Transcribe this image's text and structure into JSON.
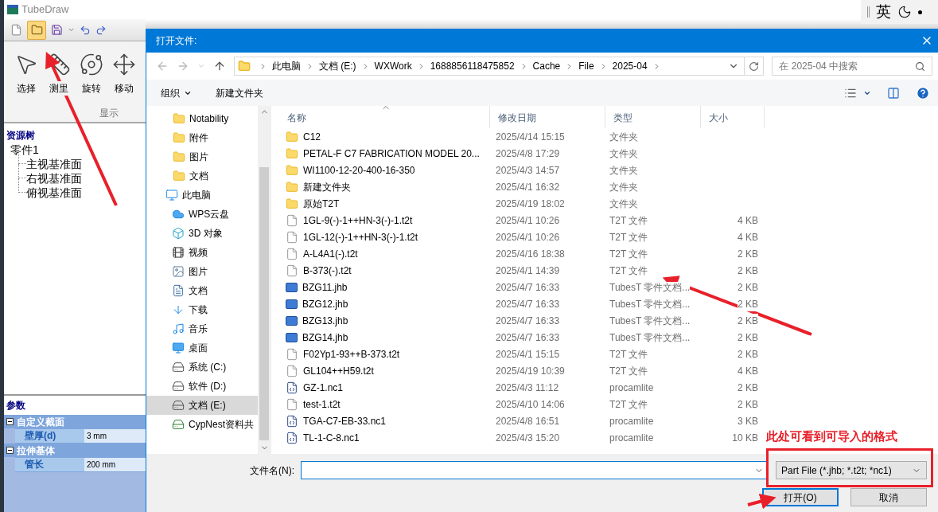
{
  "app": {
    "title": "TubeDraw",
    "ribbon": {
      "tools": [
        {
          "label": "选择",
          "kind": "pointer"
        },
        {
          "label": "测里",
          "kind": "ruler"
        },
        {
          "label": "旋转",
          "kind": "orbit"
        },
        {
          "label": "移动",
          "kind": "move"
        }
      ],
      "group": "显示"
    },
    "tree": {
      "title": "资源树",
      "root": {
        "label": "零件1",
        "children": [
          {
            "label": "主视基准面"
          },
          {
            "label": "右视基准面"
          },
          {
            "label": "俯视基准面"
          }
        ]
      }
    },
    "params": {
      "title": "参数",
      "groups": [
        {
          "label": "自定义截面",
          "expanded": true,
          "rows": [
            {
              "name": "壁厚(d)",
              "value": "3 mm"
            }
          ]
        },
        {
          "label": "拉伸基体",
          "expanded": true,
          "rows": [
            {
              "name": "管长",
              "value": "200 mm"
            }
          ]
        }
      ]
    }
  },
  "ime": {
    "label": "英"
  },
  "dialog": {
    "title": "打开文件:",
    "breadcrumb": [
      "此电脑",
      "文档 (E:)",
      "WXWork",
      "1688856118475852",
      "Cache",
      "File",
      "2025-04"
    ],
    "search": {
      "placeholder": "在 2025-04 中搜索"
    },
    "commands": [
      {
        "label": "组织",
        "dropdown": true
      },
      {
        "label": "新建文件夹",
        "dropdown": false
      }
    ],
    "nav": [
      {
        "label": "Notability",
        "kind": "folder",
        "selected": false
      },
      {
        "label": "附件",
        "kind": "folder",
        "selected": false
      },
      {
        "label": "图片",
        "kind": "folder",
        "selected": false
      },
      {
        "label": "文档",
        "kind": "folder",
        "selected": false
      },
      {
        "label": "此电脑",
        "kind": "computer",
        "selected": false
      },
      {
        "label": "WPS云盘",
        "kind": "cloud",
        "selected": false
      },
      {
        "label": "3D 对象",
        "kind": "cube",
        "selected": false
      },
      {
        "label": "视频",
        "kind": "video",
        "selected": false
      },
      {
        "label": "图片",
        "kind": "picture",
        "selected": false
      },
      {
        "label": "文档",
        "kind": "document",
        "selected": false
      },
      {
        "label": "下载",
        "kind": "download",
        "selected": false
      },
      {
        "label": "音乐",
        "kind": "music",
        "selected": false
      },
      {
        "label": "桌面",
        "kind": "desktop",
        "selected": false
      },
      {
        "label": "系统 (C:)",
        "kind": "drive",
        "selected": false
      },
      {
        "label": "软件 (D:)",
        "kind": "drive",
        "selected": false
      },
      {
        "label": "文档 (E:)",
        "kind": "drive",
        "selected": true
      },
      {
        "label": "CypNest资料共",
        "kind": "netdrive",
        "selected": false
      }
    ],
    "columns": [
      "名称",
      "修改日期",
      "类型",
      "大小"
    ],
    "files": [
      {
        "name": "C12",
        "date": "2025/4/14 15:15",
        "type": "文件夹",
        "kind": "folder"
      },
      {
        "name": "PETAL-F C7 FABRICATION MODEL 20...",
        "date": "2025/4/8 17:29",
        "type": "文件夹",
        "kind": "folder"
      },
      {
        "name": "WI1100-12-20-400-16-350",
        "date": "2025/4/3 14:57",
        "type": "文件夹",
        "kind": "folder"
      },
      {
        "name": "新建文件夹",
        "date": "2025/4/1 16:32",
        "type": "文件夹",
        "kind": "folder"
      },
      {
        "name": "原始T2T",
        "date": "2025/4/19 18:02",
        "type": "文件夹",
        "kind": "folder"
      },
      {
        "name": "1GL-9(-)-1++HN-3(-)-1.t2t",
        "date": "2025/4/1 10:26",
        "type": "T2T 文件",
        "size": "4 KB",
        "kind": "plain"
      },
      {
        "name": "1GL-12(-)-1++HN-3(-)-1.t2t",
        "date": "2025/4/1 10:26",
        "type": "T2T 文件",
        "size": "4 KB",
        "kind": "plain"
      },
      {
        "name": "A-L4A1(-).t2t",
        "date": "2025/4/16 18:38",
        "type": "T2T 文件",
        "size": "2 KB",
        "kind": "plain"
      },
      {
        "name": "B-373(-).t2t",
        "date": "2025/4/1 14:39",
        "type": "T2T 文件",
        "size": "2 KB",
        "kind": "plain"
      },
      {
        "name": "BZG11.jhb",
        "date": "2025/4/7 16:33",
        "type": "TubesT 零件文档...",
        "size": "2 KB",
        "kind": "part"
      },
      {
        "name": "BZG12.jhb",
        "date": "2025/4/7 16:33",
        "type": "TubesT 零件文档...",
        "size": "2 KB",
        "kind": "part"
      },
      {
        "name": "BZG13.jhb",
        "date": "2025/4/7 16:33",
        "type": "TubesT 零件文档...",
        "size": "2 KB",
        "kind": "part"
      },
      {
        "name": "BZG14.jhb",
        "date": "2025/4/7 16:33",
        "type": "TubesT 零件文档...",
        "size": "2 KB",
        "kind": "part"
      },
      {
        "name": "F02Yp1-93++B-373.t2t",
        "date": "2025/4/1 15:15",
        "type": "T2T 文件",
        "size": "2 KB",
        "kind": "plain"
      },
      {
        "name": "GL104++H59.t2t",
        "date": "2025/4/19 10:39",
        "type": "T2T 文件",
        "size": "4 KB",
        "kind": "plain"
      },
      {
        "name": "GZ-1.nc1",
        "date": "2025/4/3 11:12",
        "type": "procamlite",
        "size": "2 KB",
        "kind": "cam"
      },
      {
        "name": "test-1.t2t",
        "date": "2025/4/10 14:06",
        "type": "T2T 文件",
        "size": "2 KB",
        "kind": "plain"
      },
      {
        "name": "TGA-C7-EB-33.nc1",
        "date": "2025/4/8 16:51",
        "type": "procamlite",
        "size": "3 KB",
        "kind": "cam"
      },
      {
        "name": "TL-1-C-8.nc1",
        "date": "2025/4/3 15:20",
        "type": "procamlite",
        "size": "10 KB",
        "kind": "cam"
      }
    ],
    "filename": {
      "label": "文件名(N):"
    },
    "filetype": {
      "value": "Part File (*.jhb; *.t2t; *nc1)"
    },
    "buttons": [
      {
        "label": "打开(O)",
        "default": true
      },
      {
        "label": "取消",
        "default": false
      }
    ]
  },
  "annotation": {
    "text": "此处可看到可导入的格式"
  }
}
